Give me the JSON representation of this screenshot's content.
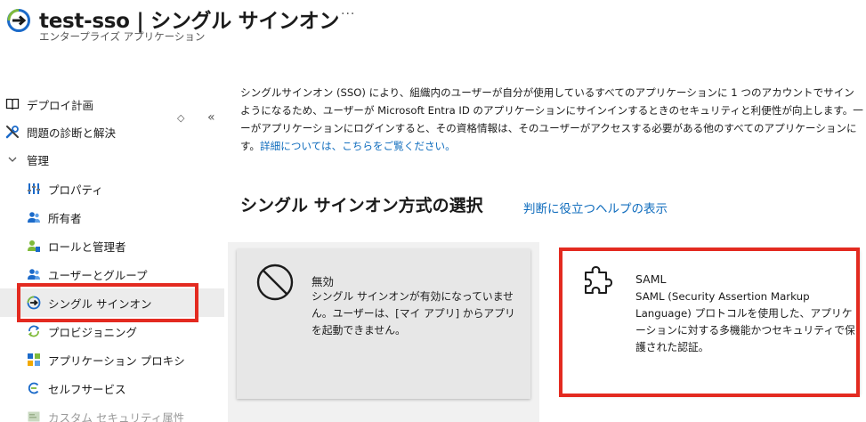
{
  "header": {
    "title": "test-sso | シングル サインオン",
    "subtitle": "エンタープライズ アプリケーション",
    "more": "···",
    "app_icon": "sso-arrow-icon"
  },
  "sidebar": {
    "sort_glyph": "◇",
    "collapse_glyph": "«",
    "items": [
      {
        "label": "デプロイ計画",
        "icon": "book-icon"
      },
      {
        "label": "問題の診断と解決",
        "icon": "wrench-icon"
      },
      {
        "label": "管理",
        "icon": "chevron-down-icon"
      },
      {
        "label": "プロパティ",
        "icon": "properties-icon"
      },
      {
        "label": "所有者",
        "icon": "owners-icon"
      },
      {
        "label": "ロールと管理者",
        "icon": "roles-icon"
      },
      {
        "label": "ユーザーとグループ",
        "icon": "users-groups-icon"
      },
      {
        "label": "シングル サインオン",
        "icon": "sso-icon"
      },
      {
        "label": "プロビジョニング",
        "icon": "provisioning-icon"
      },
      {
        "label": "アプリケーション プロキシ",
        "icon": "app-proxy-icon"
      },
      {
        "label": "セルフサービス",
        "icon": "self-service-icon"
      },
      {
        "label": "カスタム セキュリティ属性",
        "icon": "custom-security-icon"
      }
    ]
  },
  "main": {
    "description_lines": [
      "シングルサインオン (SSO) により、組織内のユーザーが自分が使用しているすべてのアプリケーションに 1 つのアカウントでサイン",
      "ようになるため、ユーザーが Microsoft Entra ID のアプリケーションにサインインするときのセキュリティと利便性が向上します。一",
      "ーがアプリケーションにログインすると、その資格情報は、そのユーザーがアクセスする必要がある他のすべてのアプリケーションに"
    ],
    "description_last_prefix": "す。",
    "learn_more_link": "詳細については、こちらをご覧ください。",
    "section_title": "シングル サインオン方式の選択",
    "help_link": "判断に役立つヘルプの表示",
    "cards": {
      "disabled": {
        "title": "無効",
        "text": "シングル サインオンが有効になっていません。ユーザーは、[マイ アプリ] からアプリを起動できません。",
        "icon": "prohibited-icon"
      },
      "saml": {
        "title": "SAML",
        "text": "SAML (Security Assertion Markup Language) プロトコルを使用した、アプリケーションに対する多機能かつセキュリティで保護された認証。",
        "icon": "puzzle-icon"
      }
    }
  },
  "colors": {
    "accent_link": "#0f6cbd",
    "highlight_red": "#e32a20",
    "active_bg": "#ececec"
  }
}
